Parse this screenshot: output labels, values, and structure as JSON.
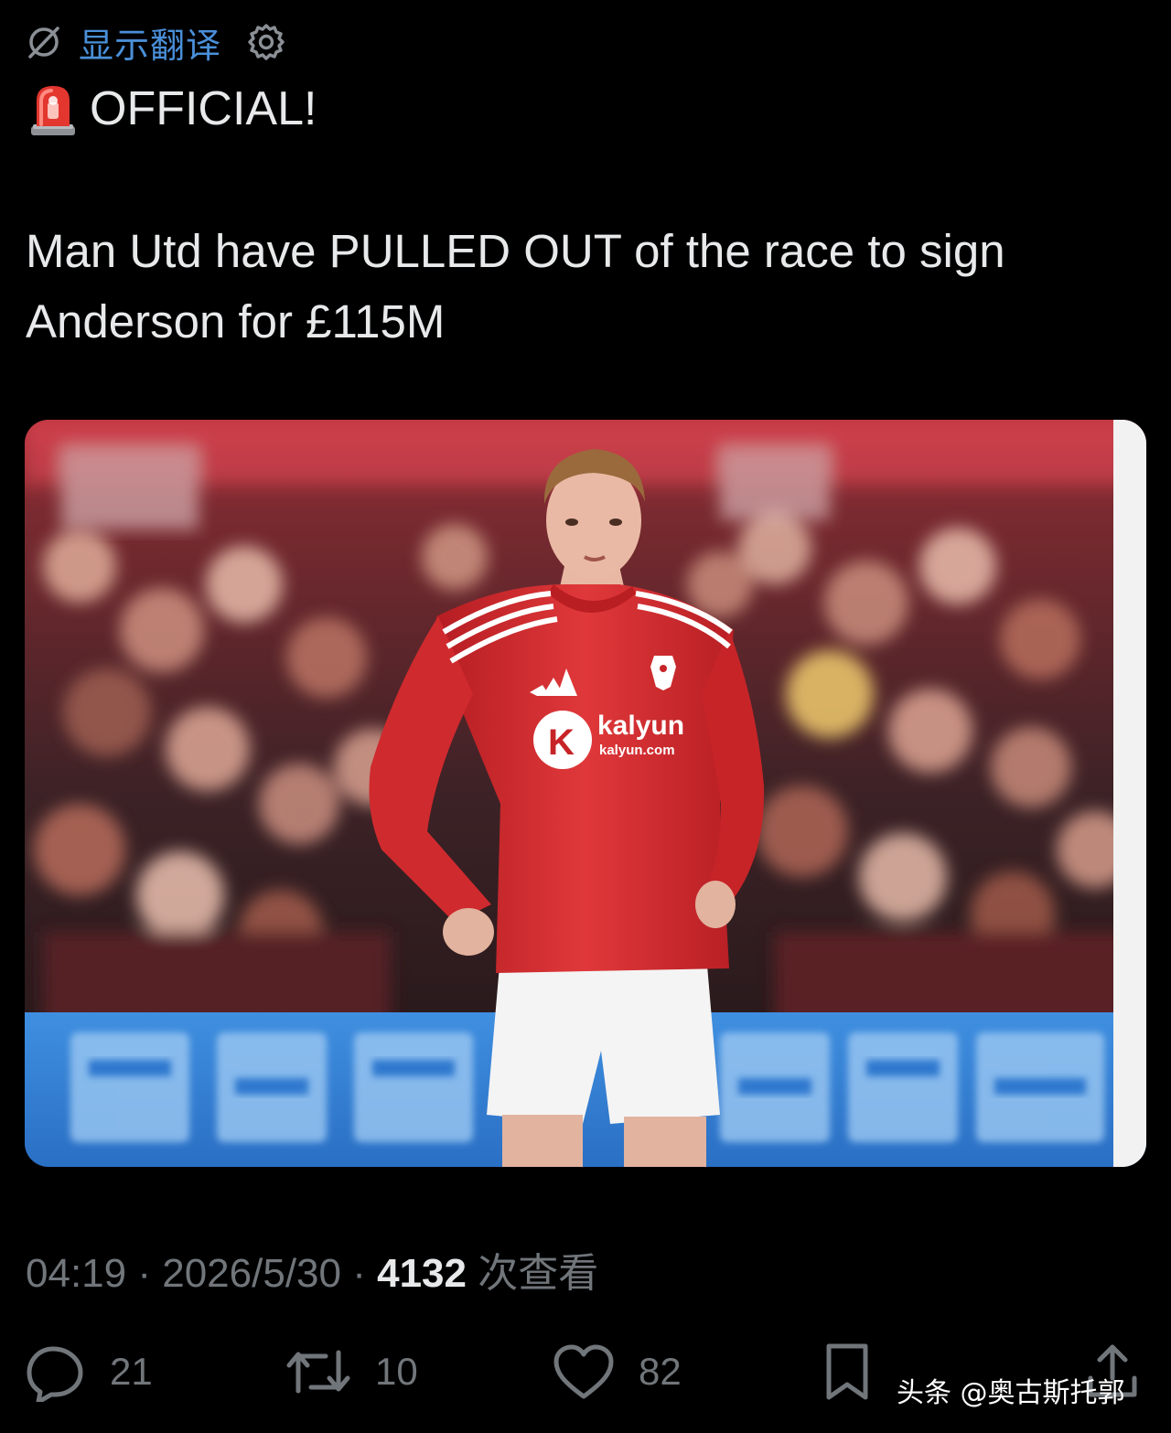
{
  "translate": {
    "link_label": "显示翻译",
    "icon": "globe-off-icon",
    "settings_icon": "gear-icon"
  },
  "post": {
    "headline_emoji": "police-siren-icon",
    "headline": "OFFICIAL!",
    "body_line1": "Man Utd have PULLED OUT of the race to sign",
    "body_line2": "Anderson for £115M",
    "image": {
      "jersey_sponsor": "kalyun",
      "jersey_sponsor_url": "kalyun.com",
      "sponsor_logo_letter": "K"
    },
    "time": "04:19",
    "separator": "·",
    "date": "2026/5/30",
    "views_count": "4132",
    "views_label": "次查看"
  },
  "actions": {
    "reply_count": "21",
    "repost_count": "10",
    "like_count": "82",
    "bookmark_icon": "bookmark-icon",
    "share_icon": "share-icon"
  },
  "watermark": {
    "text": "头条 @奥古斯托郭"
  },
  "colors": {
    "background": "#000000",
    "text_primary": "#e7e9ea",
    "text_secondary": "#71767b",
    "link": "#4a8fd8",
    "jersey_red": "#d42a2c"
  }
}
